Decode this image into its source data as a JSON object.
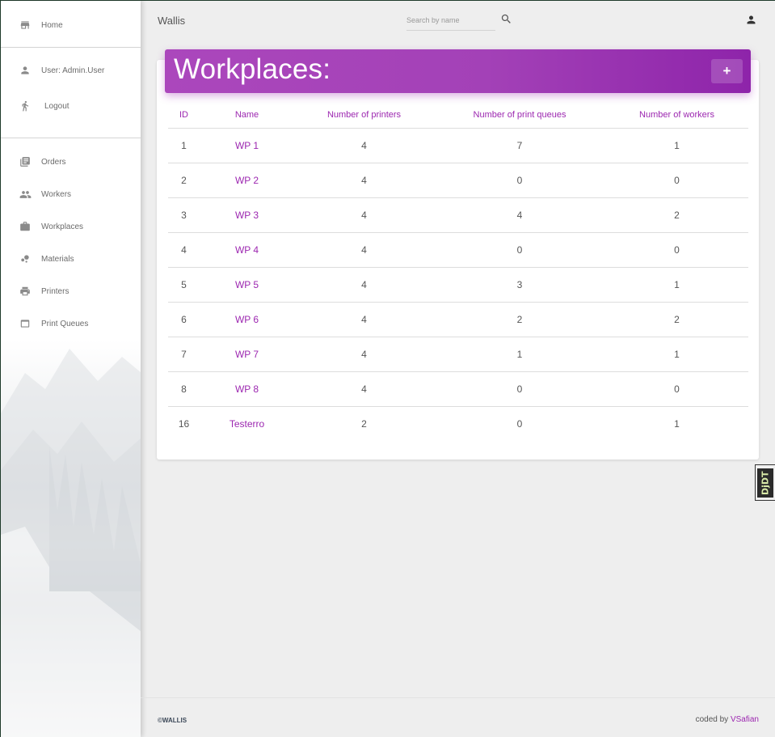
{
  "topbar": {
    "title": "Wallis",
    "search_placeholder": "Search by name"
  },
  "sidebar": {
    "account": [
      {
        "label": "Home",
        "icon": "store-icon"
      },
      {
        "label": "User: Admin.User",
        "icon": "person-icon"
      },
      {
        "label": "Logout",
        "icon": "run-icon"
      }
    ],
    "items": [
      {
        "label": "Orders",
        "icon": "library-books-icon"
      },
      {
        "label": "Workers",
        "icon": "group-icon"
      },
      {
        "label": "Workplaces",
        "icon": "briefcase-icon"
      },
      {
        "label": "Materials",
        "icon": "bubble-chart-icon"
      },
      {
        "label": "Printers",
        "icon": "printer-icon"
      },
      {
        "label": "Print Queues",
        "icon": "web-asset-icon"
      }
    ]
  },
  "card": {
    "title": "Workplaces:",
    "add_label": "+"
  },
  "table": {
    "headers": [
      "ID",
      "Name",
      "Number of printers",
      "Number of print queues",
      "Number of workers"
    ],
    "rows": [
      [
        "1",
        "WP 1",
        "4",
        "7",
        "1"
      ],
      [
        "2",
        "WP 2",
        "4",
        "0",
        "0"
      ],
      [
        "3",
        "WP 3",
        "4",
        "4",
        "2"
      ],
      [
        "4",
        "WP 4",
        "4",
        "0",
        "0"
      ],
      [
        "5",
        "WP 5",
        "4",
        "3",
        "1"
      ],
      [
        "6",
        "WP 6",
        "4",
        "2",
        "2"
      ],
      [
        "7",
        "WP 7",
        "4",
        "1",
        "1"
      ],
      [
        "8",
        "WP 8",
        "4",
        "0",
        "0"
      ],
      [
        "16",
        "Testerro",
        "2",
        "0",
        "1"
      ]
    ]
  },
  "footer": {
    "copyright": "©WALLIS",
    "coded_by_prefix": "coded by ",
    "author": "VSafian"
  },
  "debug_toolbar": {
    "label": "DjDT"
  },
  "colors": {
    "accent": "#9c27b0",
    "header_gradient_start": "#ab47bc",
    "header_gradient_end": "#8e24aa",
    "background": "#eeeeee"
  }
}
